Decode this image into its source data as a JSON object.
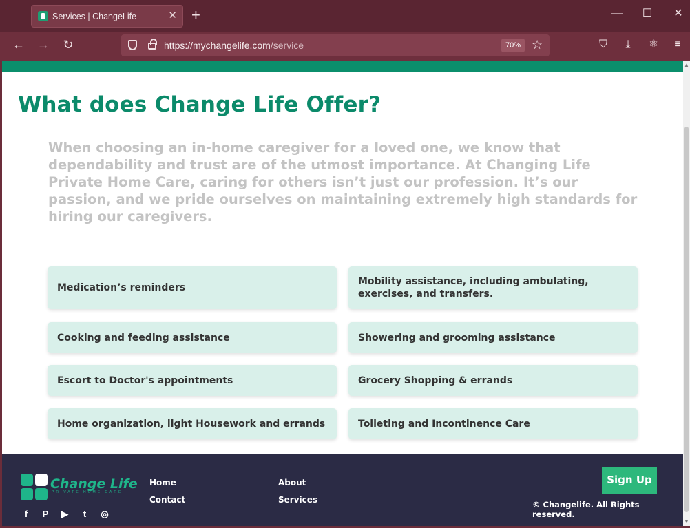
{
  "browser": {
    "tab_title": "Services | ChangeLife",
    "tab_close": "✕",
    "new_tab": "+",
    "window_controls": {
      "minimize": "—",
      "maximize": "☐",
      "close": "✕"
    },
    "url_host": "https://mychangelife.com",
    "url_path": "/service",
    "zoom": "70%",
    "icons": [
      "back-arrow-icon",
      "forward-arrow-icon",
      "reload-icon",
      "shield-icon",
      "lock-icon",
      "star-icon",
      "pocket-icon",
      "download-icon",
      "extension-icon",
      "menu-icon"
    ],
    "nav_glyphs": {
      "back": "←",
      "forward": "→",
      "reload": "↻",
      "star": "☆",
      "pocket": "⛉",
      "download": "⤓",
      "extension": "⚛",
      "menu": "≡"
    }
  },
  "page": {
    "heading": "What does Change Life Offer?",
    "intro": "When choosing an in-home caregiver for a loved one, we know that dependability and trust are of the utmost importance. At Changing Life Private Home Care, caring for others isn’t just our profession. It’s our passion, and we pride ourselves on maintaining extremely high standards for hiring our caregivers.",
    "services": [
      "Medication’s reminders",
      "Mobility assistance, including ambulating, exercises, and transfers.",
      "Cooking and feeding assistance",
      "Showering and grooming assistance",
      "Escort to Doctor's appointments",
      "Grocery Shopping & errands",
      "Home organization, light Housework and errands",
      "Toileting and Incontinence Care"
    ],
    "colors": {
      "brand_green": "#0b8a6a",
      "card_bg": "#d9f0ea",
      "footer_bg": "#2b2b45",
      "signup_bg": "#2db87c"
    }
  },
  "footer": {
    "logo_text": "Change Life",
    "logo_sub": "PRIVATE HOME CARE",
    "links": {
      "home": "Home",
      "about": "About",
      "contact": "Contact",
      "services": "Services"
    },
    "signup": "Sign Up",
    "copyright": "© Changelife. All Rights reserved.",
    "social": {
      "facebook": "f",
      "pinterest": "P",
      "youtube": "▶",
      "twitter": "t",
      "instagram": "◎"
    }
  }
}
